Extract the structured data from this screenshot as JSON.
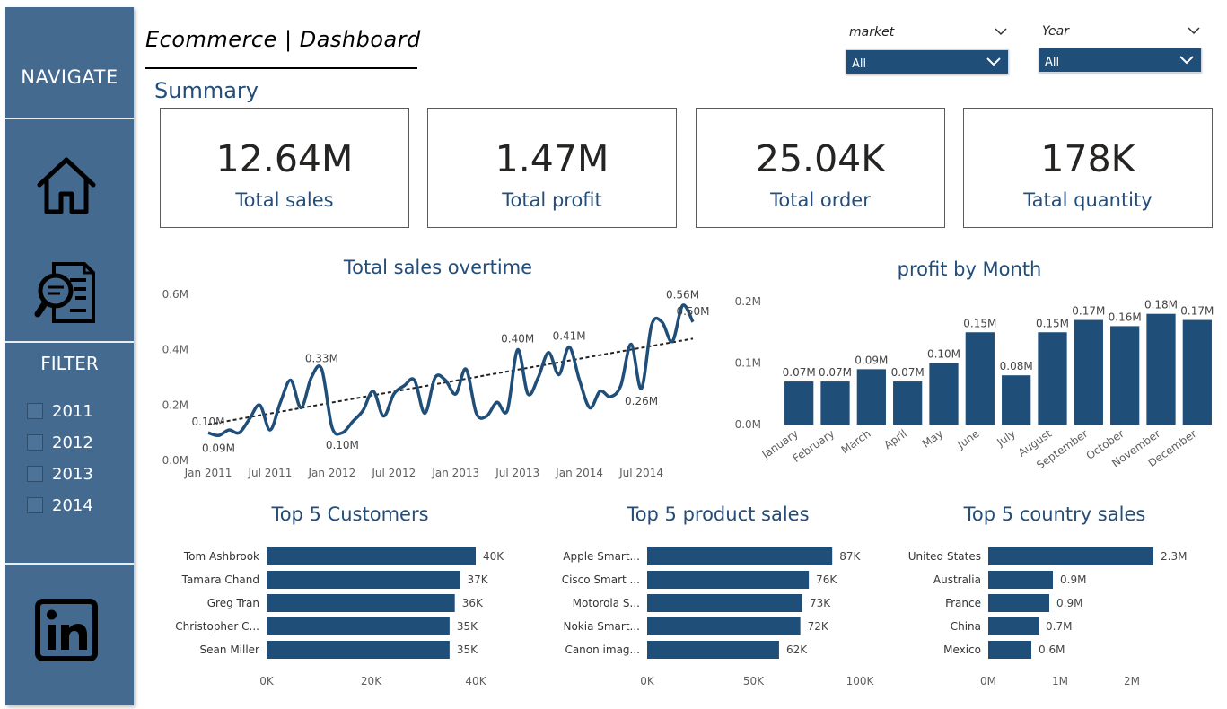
{
  "sidebar": {
    "navigate_label": "NAVIGATE",
    "filter_label": "FILTER",
    "icons": [
      "home-icon",
      "report-search-icon",
      "linkedin-icon"
    ],
    "years": [
      "2011",
      "2012",
      "2013",
      "2014"
    ]
  },
  "header": {
    "title": "Ecommerce | Dashboard",
    "summary_label": "Summary"
  },
  "slicers": {
    "market": {
      "label": "market",
      "value": "All"
    },
    "year": {
      "label": "Year",
      "value": "All"
    }
  },
  "kpis": [
    {
      "value": "12.64M",
      "label": "Total sales"
    },
    {
      "value": "1.47M",
      "label": "Total profit"
    },
    {
      "value": "25.04K",
      "label": "Total order"
    },
    {
      "value": "178K",
      "label": "Tatal quantity"
    }
  ],
  "colors": {
    "accent": "#1f4e79",
    "sidebar": "#446a8f",
    "title": "#244d79"
  },
  "chart_data": [
    {
      "type": "line",
      "title": "Total sales overtime",
      "y_ticks": [
        "0.6M",
        "0.4M",
        "0.2M",
        "0.0M"
      ],
      "ylim": [
        0,
        0.6
      ],
      "x_ticks": [
        "Jan 2011",
        "Jul 2011",
        "Jan 2012",
        "Jul 2012",
        "Jan 2013",
        "Jul 2013",
        "Jan 2014",
        "Jul 2014"
      ],
      "x": [
        "Jan 2011",
        "Feb 2011",
        "Mar 2011",
        "Apr 2011",
        "May 2011",
        "Jun 2011",
        "Jul 2011",
        "Aug 2011",
        "Sep 2011",
        "Oct 2011",
        "Nov 2011",
        "Dec 2011",
        "Jan 2012",
        "Feb 2012",
        "Mar 2012",
        "Apr 2012",
        "May 2012",
        "Jun 2012",
        "Jul 2012",
        "Aug 2012",
        "Sep 2012",
        "Oct 2012",
        "Nov 2012",
        "Dec 2012",
        "Jan 2013",
        "Feb 2013",
        "Mar 2013",
        "Apr 2013",
        "May 2013",
        "Jun 2013",
        "Jul 2013",
        "Aug 2013",
        "Sep 2013",
        "Oct 2013",
        "Nov 2013",
        "Dec 2013",
        "Jan 2014",
        "Feb 2014",
        "Mar 2014",
        "Apr 2014",
        "May 2014",
        "Jun 2014",
        "Jul 2014",
        "Aug 2014",
        "Sep 2014",
        "Oct 2014",
        "Nov 2014",
        "Dec 2014"
      ],
      "values": [
        0.1,
        0.09,
        0.11,
        0.1,
        0.15,
        0.2,
        0.11,
        0.21,
        0.29,
        0.19,
        0.3,
        0.33,
        0.12,
        0.1,
        0.14,
        0.18,
        0.25,
        0.16,
        0.24,
        0.27,
        0.29,
        0.17,
        0.3,
        0.29,
        0.24,
        0.33,
        0.17,
        0.16,
        0.21,
        0.18,
        0.4,
        0.24,
        0.3,
        0.39,
        0.31,
        0.41,
        0.29,
        0.19,
        0.25,
        0.23,
        0.27,
        0.42,
        0.26,
        0.49,
        0.5,
        0.43,
        0.56,
        0.5
      ],
      "trend": [
        0.13,
        0.44
      ],
      "data_labels": [
        {
          "text": "0.10M",
          "index": 0,
          "pos": "above"
        },
        {
          "text": "0.09M",
          "index": 1,
          "pos": "below"
        },
        {
          "text": "0.33M",
          "index": 11,
          "pos": "above"
        },
        {
          "text": "0.10M",
          "index": 13,
          "pos": "below"
        },
        {
          "text": "0.40M",
          "index": 30,
          "pos": "above"
        },
        {
          "text": "0.41M",
          "index": 35,
          "pos": "above"
        },
        {
          "text": "0.26M",
          "index": 42,
          "pos": "below"
        },
        {
          "text": "0.56M",
          "index": 46,
          "pos": "above"
        },
        {
          "text": "0.50M",
          "index": 47,
          "pos": "above"
        }
      ]
    },
    {
      "type": "bar",
      "title": "profit by Month",
      "y_ticks": [
        "0.2M",
        "0.1M",
        "0.0M"
      ],
      "ylim": [
        0,
        0.2
      ],
      "categories": [
        "January",
        "February",
        "March",
        "April",
        "May",
        "June",
        "July",
        "August",
        "September",
        "October",
        "November",
        "December"
      ],
      "values": [
        0.07,
        0.07,
        0.09,
        0.07,
        0.1,
        0.15,
        0.08,
        0.15,
        0.17,
        0.16,
        0.18,
        0.17
      ],
      "labels": [
        "0.07M",
        "0.07M",
        "0.09M",
        "0.07M",
        "0.10M",
        "0.15M",
        "0.08M",
        "0.15M",
        "0.17M",
        "0.16M",
        "0.18M",
        "0.17M"
      ]
    },
    {
      "type": "bar",
      "orientation": "horizontal",
      "title": "Top 5 Customers",
      "categories": [
        "Tom Ashbrook",
        "Tamara Chand",
        "Greg Tran",
        "Christopher C...",
        "Sean Miller"
      ],
      "values": [
        40,
        37,
        36,
        35,
        35
      ],
      "labels": [
        "40K",
        "37K",
        "36K",
        "35K",
        "35K"
      ],
      "x_ticks": [
        "0K",
        "20K",
        "40K"
      ],
      "xlim": [
        0,
        40
      ]
    },
    {
      "type": "bar",
      "orientation": "horizontal",
      "title": "Top 5 product sales",
      "categories": [
        "Apple Smart...",
        "Cisco Smart ...",
        "Motorola S...",
        "Nokia Smart...",
        "Canon imag..."
      ],
      "values": [
        87,
        76,
        73,
        72,
        62
      ],
      "labels": [
        "87K",
        "76K",
        "73K",
        "72K",
        "62K"
      ],
      "x_ticks": [
        "0K",
        "50K",
        "100K"
      ],
      "xlim": [
        0,
        100
      ]
    },
    {
      "type": "bar",
      "orientation": "horizontal",
      "title": "Top 5 country sales",
      "categories": [
        "United States",
        "Australia",
        "France",
        "China",
        "Mexico"
      ],
      "values": [
        2.3,
        0.9,
        0.85,
        0.7,
        0.6
      ],
      "labels": [
        "2.3M",
        "0.9M",
        "0.9M",
        "0.7M",
        "0.6M"
      ],
      "x_ticks": [
        "0M",
        "1M",
        "2M"
      ],
      "xlim": [
        0,
        2
      ]
    }
  ]
}
